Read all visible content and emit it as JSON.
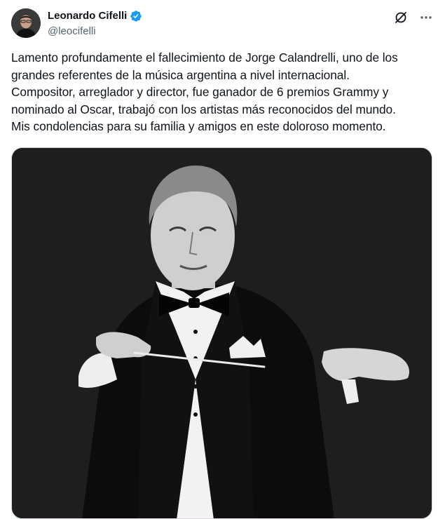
{
  "author": {
    "name": "Leonardo Cifelli",
    "handle": "@leocifelli",
    "verified": true,
    "avatar_icon": "user-avatar"
  },
  "actions": {
    "grok_icon": "grok-icon",
    "more_icon": "more-dots-icon"
  },
  "tweet": {
    "text": "Lamento profundamente el fallecimiento de Jorge Calandrelli, uno de los grandes referentes de la música argentina a nivel internacional.\nCompositor, arreglador y director, fue ganador de 6 premios Grammy y nominado al Oscar, trabajó con los artistas más reconocidos del mundo.\nMis condolencias para su familia y amigos en este doloroso momento."
  },
  "media": {
    "alt": "Black and white photo of a conductor in tuxedo and bow tie holding a baton",
    "background": "#1e1e1e"
  },
  "colors": {
    "verified": "#1d9bf0",
    "handle": "#536471",
    "text": "#0f1419"
  }
}
